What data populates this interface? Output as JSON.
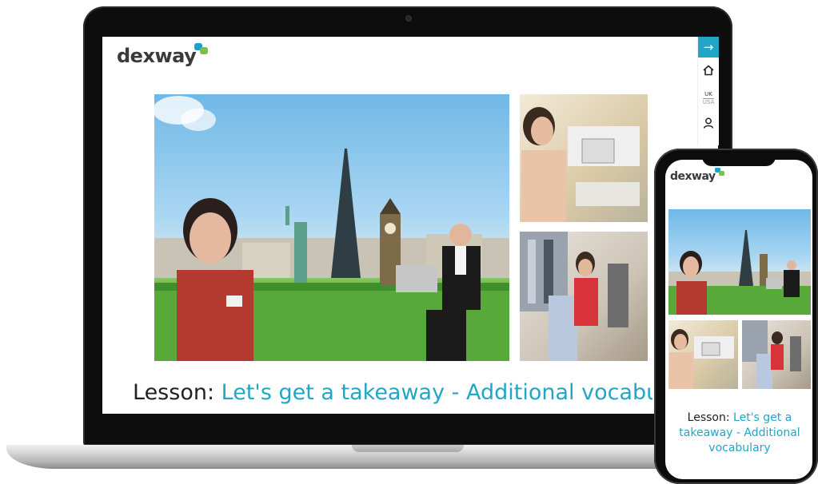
{
  "app": {
    "logo": "dexway",
    "colors": {
      "accent": "#22a6c7",
      "logo_blue": "#1f9fd0",
      "logo_green": "#7cc242"
    }
  },
  "laptop": {
    "sidebar": [
      {
        "icon": "arrow-right-icon"
      },
      {
        "icon": "home-icon"
      },
      {
        "lang_top": "UK",
        "lang_bottom": "USA"
      },
      {
        "icon": "user-icon"
      }
    ],
    "images": [
      {
        "name": "hero-landmarks-image"
      },
      {
        "name": "cashier-image"
      },
      {
        "name": "clothes-shop-image"
      }
    ],
    "lesson": {
      "prefix": "Lesson: ",
      "title": "Let's get a takeaway - Additional vocabular"
    }
  },
  "phone": {
    "lesson": {
      "prefix": "Lesson: ",
      "title": "Let's get a takeaway - Additional vocabulary"
    }
  }
}
